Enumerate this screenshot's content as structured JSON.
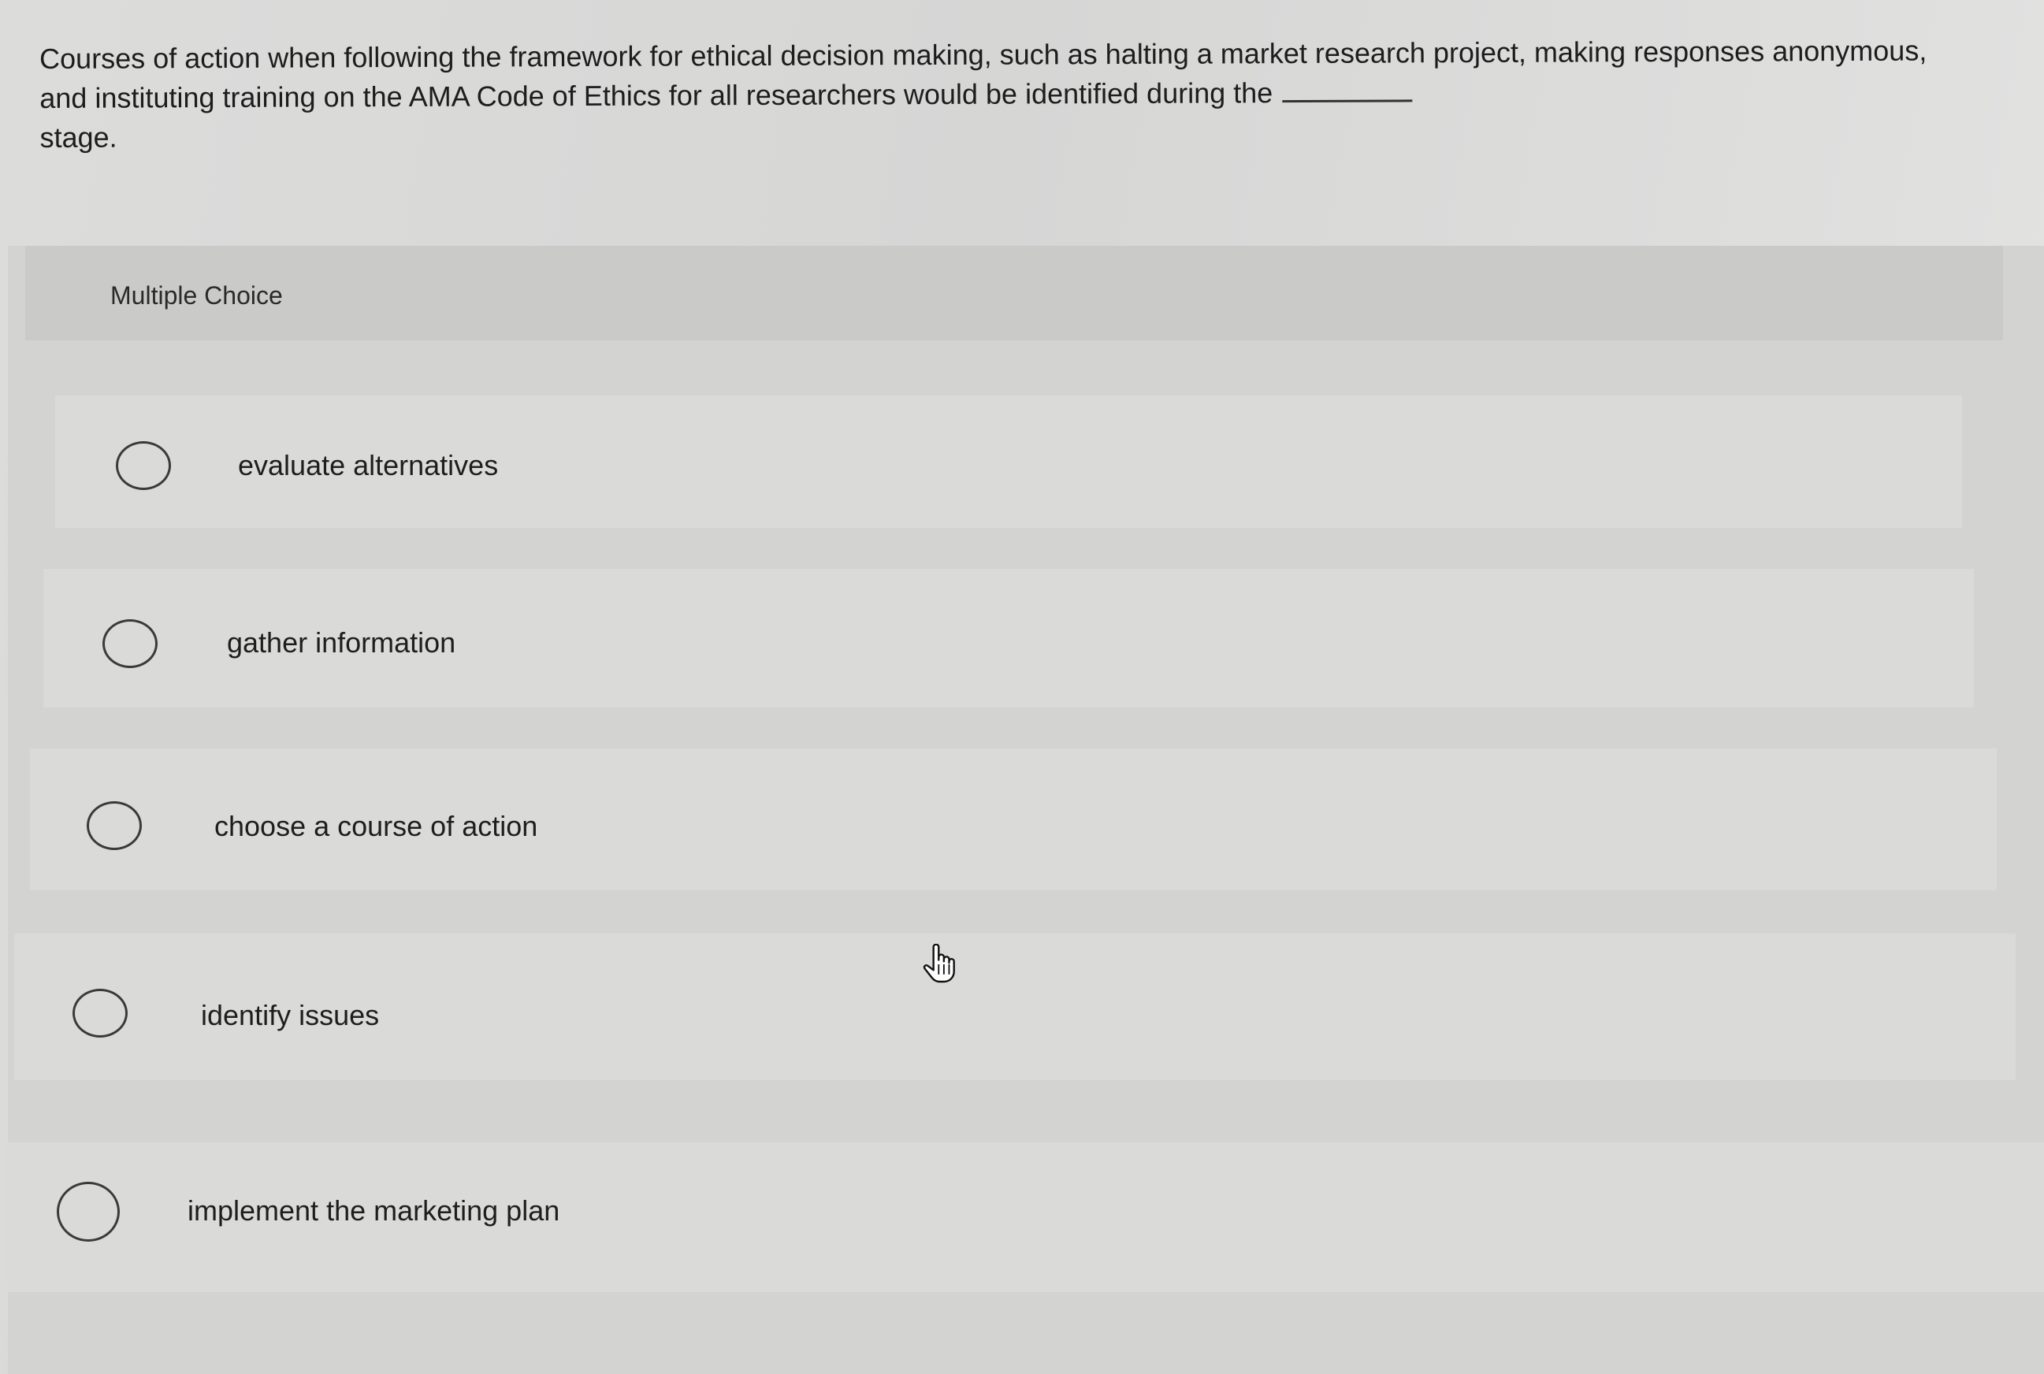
{
  "question": {
    "text": "Courses of action when following the framework for ethical decision making, such as halting a market research project, making responses anonymous, and instituting training on the AMA Code of Ethics for all researchers would be identified during the",
    "text_after_blank": "stage."
  },
  "multiple_choice": {
    "label": "Multiple Choice",
    "options": [
      {
        "label": "evaluate alternatives",
        "selected": false
      },
      {
        "label": "gather information",
        "selected": false
      },
      {
        "label": "choose a course of action",
        "selected": false
      },
      {
        "label": "identify issues",
        "selected": false
      },
      {
        "label": "implement the marketing plan",
        "selected": false
      }
    ]
  },
  "cursor": {
    "icon": "hand-pointer-icon"
  }
}
